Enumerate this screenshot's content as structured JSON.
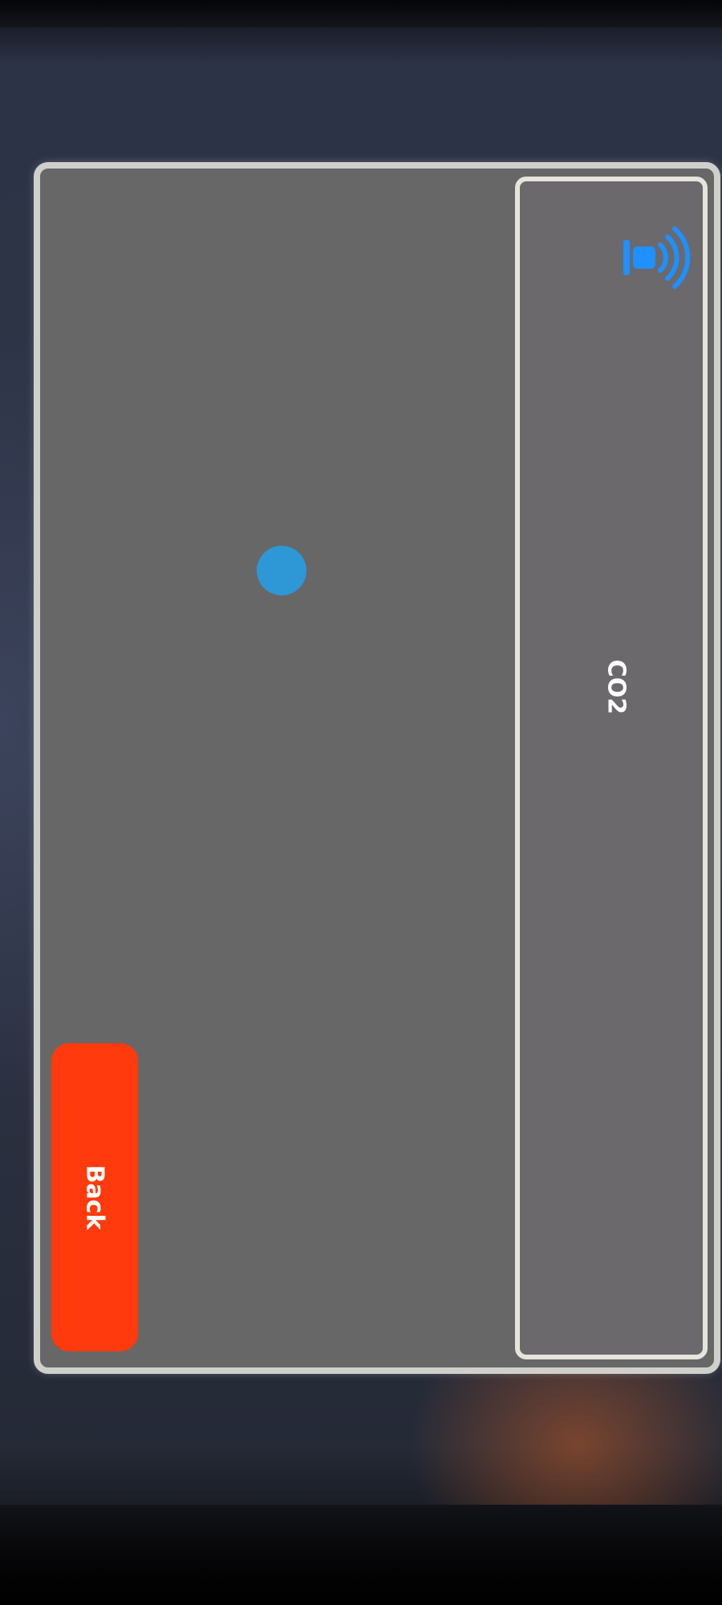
{
  "sidebar": {
    "icon": "wifi-signal-icon",
    "label": "CO2"
  },
  "main": {
    "indicator_color": "#2e97d6",
    "back_label": "Back",
    "back_color": "#ff3a0c"
  }
}
